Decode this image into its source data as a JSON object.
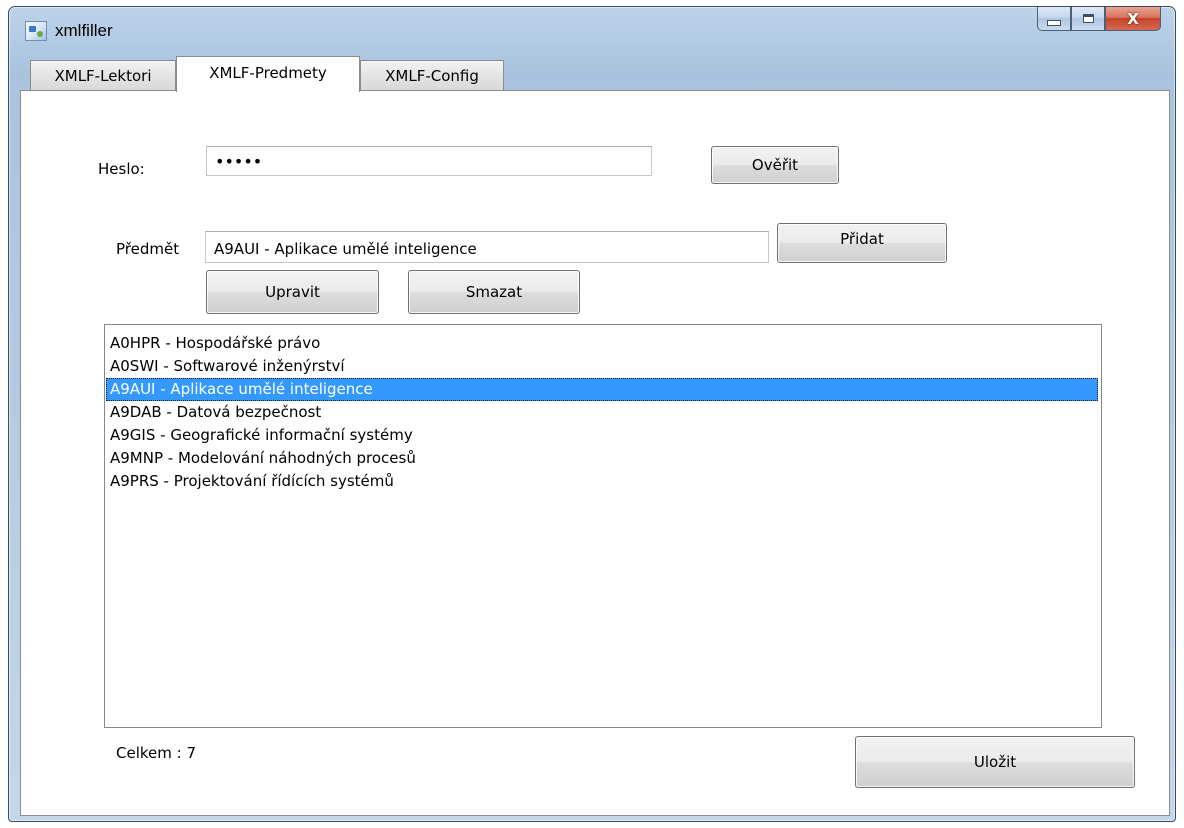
{
  "window": {
    "title": "xmlfiller",
    "close_glyph": "X",
    "icon": "app-icon"
  },
  "tabs": [
    {
      "label": "XMLF-Lektori",
      "active": false
    },
    {
      "label": "XMLF-Predmety",
      "active": true
    },
    {
      "label": "XMLF-Config",
      "active": false
    }
  ],
  "password": {
    "label": "Heslo:",
    "value": "•••••",
    "verify_label": "Ověřit"
  },
  "subject": {
    "label": "Předmět",
    "value": "A9AUI - Aplikace umělé inteligence",
    "add_label": "Přidat",
    "edit_label": "Upravit",
    "delete_label": "Smazat"
  },
  "subjects_list": {
    "items": [
      "A0HPR - Hospodářské právo",
      "A0SWI - Softwarové inženýrství",
      "A9AUI - Aplikace umělé inteligence",
      "A9DAB - Datová bezpečnost",
      "A9GIS - Geografické informační systémy",
      "A9MNP - Modelování náhodných procesů",
      "A9PRS - Projektování řídících systémů"
    ],
    "selected_index": 2,
    "selection_color": "#3399ff"
  },
  "footer": {
    "total_label": "Celkem : 7",
    "save_label": "Uložit"
  }
}
